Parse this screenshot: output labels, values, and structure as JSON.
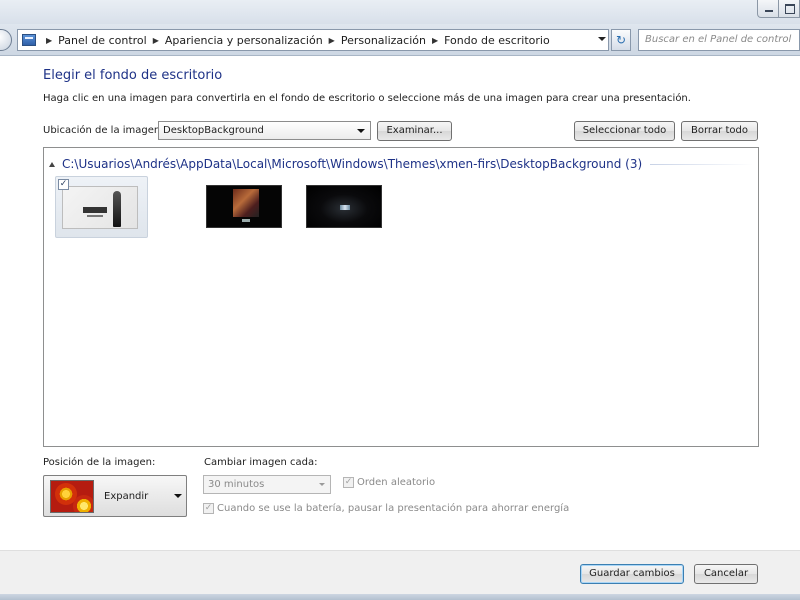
{
  "window": {
    "breadcrumbs": [
      "Panel de control",
      "Apariencia y personalización",
      "Personalización",
      "Fondo de escritorio"
    ],
    "search_placeholder": "Buscar en el Panel de control"
  },
  "content": {
    "title": "Elegir el fondo de escritorio",
    "instruction": "Haga clic en una imagen para convertirla en el fondo de escritorio o seleccione más de una imagen para crear una presentación.",
    "location_label": "Ubicación de la imagen:",
    "location_value": "DesktopBackground",
    "browse_label": "Examinar...",
    "select_all_label": "Seleccionar todo",
    "clear_all_label": "Borrar todo",
    "group_path": "C:\\Usuarios\\Andrés\\AppData\\Local\\Microsoft\\Windows\\Themes\\xmen-firs\\DesktopBackground (3)",
    "thumbnails": [
      {
        "checked": true
      },
      {
        "checked": false
      },
      {
        "checked": false
      }
    ]
  },
  "options": {
    "position_label": "Posición de la imagen:",
    "position_value": "Expandir",
    "change_label": "Cambiar imagen cada:",
    "interval_value": "30 minutos",
    "shuffle_label": "Orden aleatorio",
    "battery_label": "Cuando se use la batería, pausar la presentación para ahorrar energía"
  },
  "footer": {
    "save_label": "Guardar cambios",
    "cancel_label": "Cancelar"
  },
  "icons": {
    "check_glyph": "✓",
    "refresh_glyph": "↻",
    "separator_glyph": "▶"
  }
}
